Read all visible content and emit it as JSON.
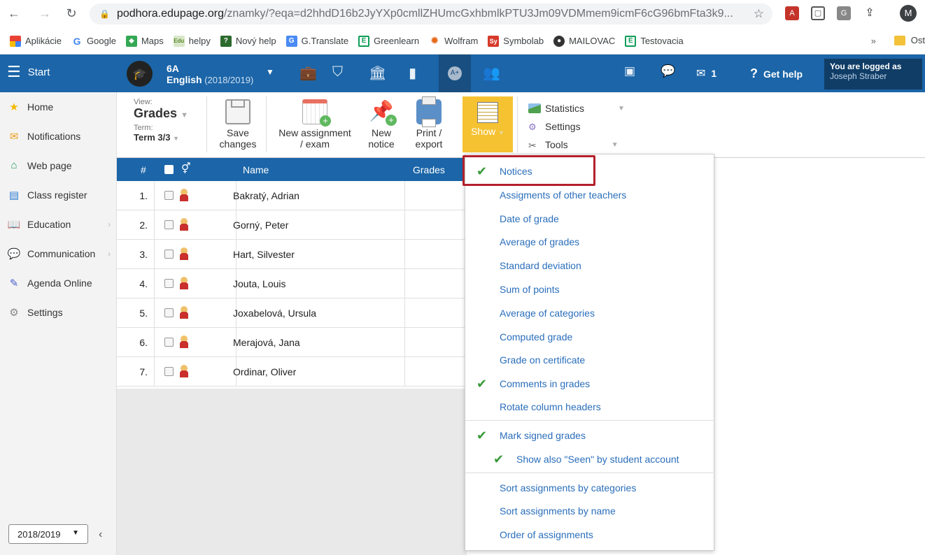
{
  "browser": {
    "url_host": "podhora.edupage.org",
    "url_path": "/znamky/?eqa=d2hhdD16b2JyYXp0cmllZHUmcGxhbmlkPTU3Jm09VDMmem9icmF6cG96bmFta3k9...",
    "profile_initial": "M",
    "bookmarks": [
      "Aplikácie",
      "Google",
      "Maps",
      "helpy",
      "Nový help",
      "G.Translate",
      "Greenlearn",
      "Wolfram",
      "Symbolab",
      "MAILOVAC",
      "Testovacia"
    ],
    "bookmarks_more": "»",
    "bookmarks_folder": "Ost"
  },
  "header": {
    "start_label": "Start",
    "class_name": "6A",
    "subject": "English",
    "year": "(2018/2019)",
    "messages_count": "1",
    "help_label": "Get help",
    "logged_label": "You are logged as",
    "user_name": "Joseph Straber"
  },
  "sidebar": {
    "items": [
      {
        "label": "Home",
        "icon": "star-icon"
      },
      {
        "label": "Notifications",
        "icon": "envelope-icon"
      },
      {
        "label": "Web page",
        "icon": "house-icon"
      },
      {
        "label": "Class register",
        "icon": "register-icon"
      },
      {
        "label": "Education",
        "icon": "book-icon"
      },
      {
        "label": "Communication",
        "icon": "chat-icon"
      },
      {
        "label": "Agenda Online",
        "icon": "pen-icon"
      },
      {
        "label": "Settings",
        "icon": "gear-icon"
      }
    ],
    "year_value": "2018/2019"
  },
  "toolbar": {
    "view_label": "View:",
    "view_value": "Grades",
    "term_label": "Term:",
    "term_value": "Term 3/3",
    "save_label_1": "Save",
    "save_label_2": "changes",
    "new_assignment_1": "New assignment",
    "new_assignment_2": "/ exam",
    "new_notice_1": "New",
    "new_notice_2": "notice",
    "print_1": "Print /",
    "print_2": "export",
    "show_label": "Show",
    "statistics_label": "Statistics",
    "settings_label": "Settings",
    "tools_label": "Tools"
  },
  "table": {
    "headers": {
      "num": "#",
      "name": "Name",
      "grades": "Grades"
    },
    "rows": [
      {
        "num": "1.",
        "name": "Bakratý, Adrian"
      },
      {
        "num": "2.",
        "name": "Gorný, Peter"
      },
      {
        "num": "3.",
        "name": "Hart, Silvester"
      },
      {
        "num": "4.",
        "name": "Jouta, Louis"
      },
      {
        "num": "5.",
        "name": "Joxabelová, Ursula"
      },
      {
        "num": "6.",
        "name": "Merajová, Jana"
      },
      {
        "num": "7.",
        "name": "Ordinar, Oliver"
      }
    ]
  },
  "show_menu": {
    "items": [
      {
        "label": "Notices",
        "checked": true
      },
      {
        "label": "Assigments of other teachers",
        "checked": false
      },
      {
        "label": "Date of grade",
        "checked": false
      },
      {
        "label": "Average of grades",
        "checked": false
      },
      {
        "label": "Standard deviation",
        "checked": false
      },
      {
        "label": "Sum of points",
        "checked": false
      },
      {
        "label": "Average of categories",
        "checked": false
      },
      {
        "label": "Computed grade",
        "checked": false
      },
      {
        "label": "Grade on certificate",
        "checked": false
      },
      {
        "label": "Comments in grades",
        "checked": true
      },
      {
        "label": "Rotate column headers",
        "checked": false
      },
      {
        "label": "Mark signed grades",
        "checked": true
      },
      {
        "label": "Show also \"Seen\" by student account",
        "checked": true
      },
      {
        "label": "Sort assignments by categories",
        "checked": false
      },
      {
        "label": "Sort assignments by name",
        "checked": false
      },
      {
        "label": "Order of assignments",
        "checked": false
      }
    ]
  },
  "colors": {
    "header_blue": "#1b65a8",
    "show_yellow": "#f5c232",
    "link_blue": "#2a6ebb",
    "check_green": "#3a9a3a",
    "highlight_red": "#b3202b"
  }
}
